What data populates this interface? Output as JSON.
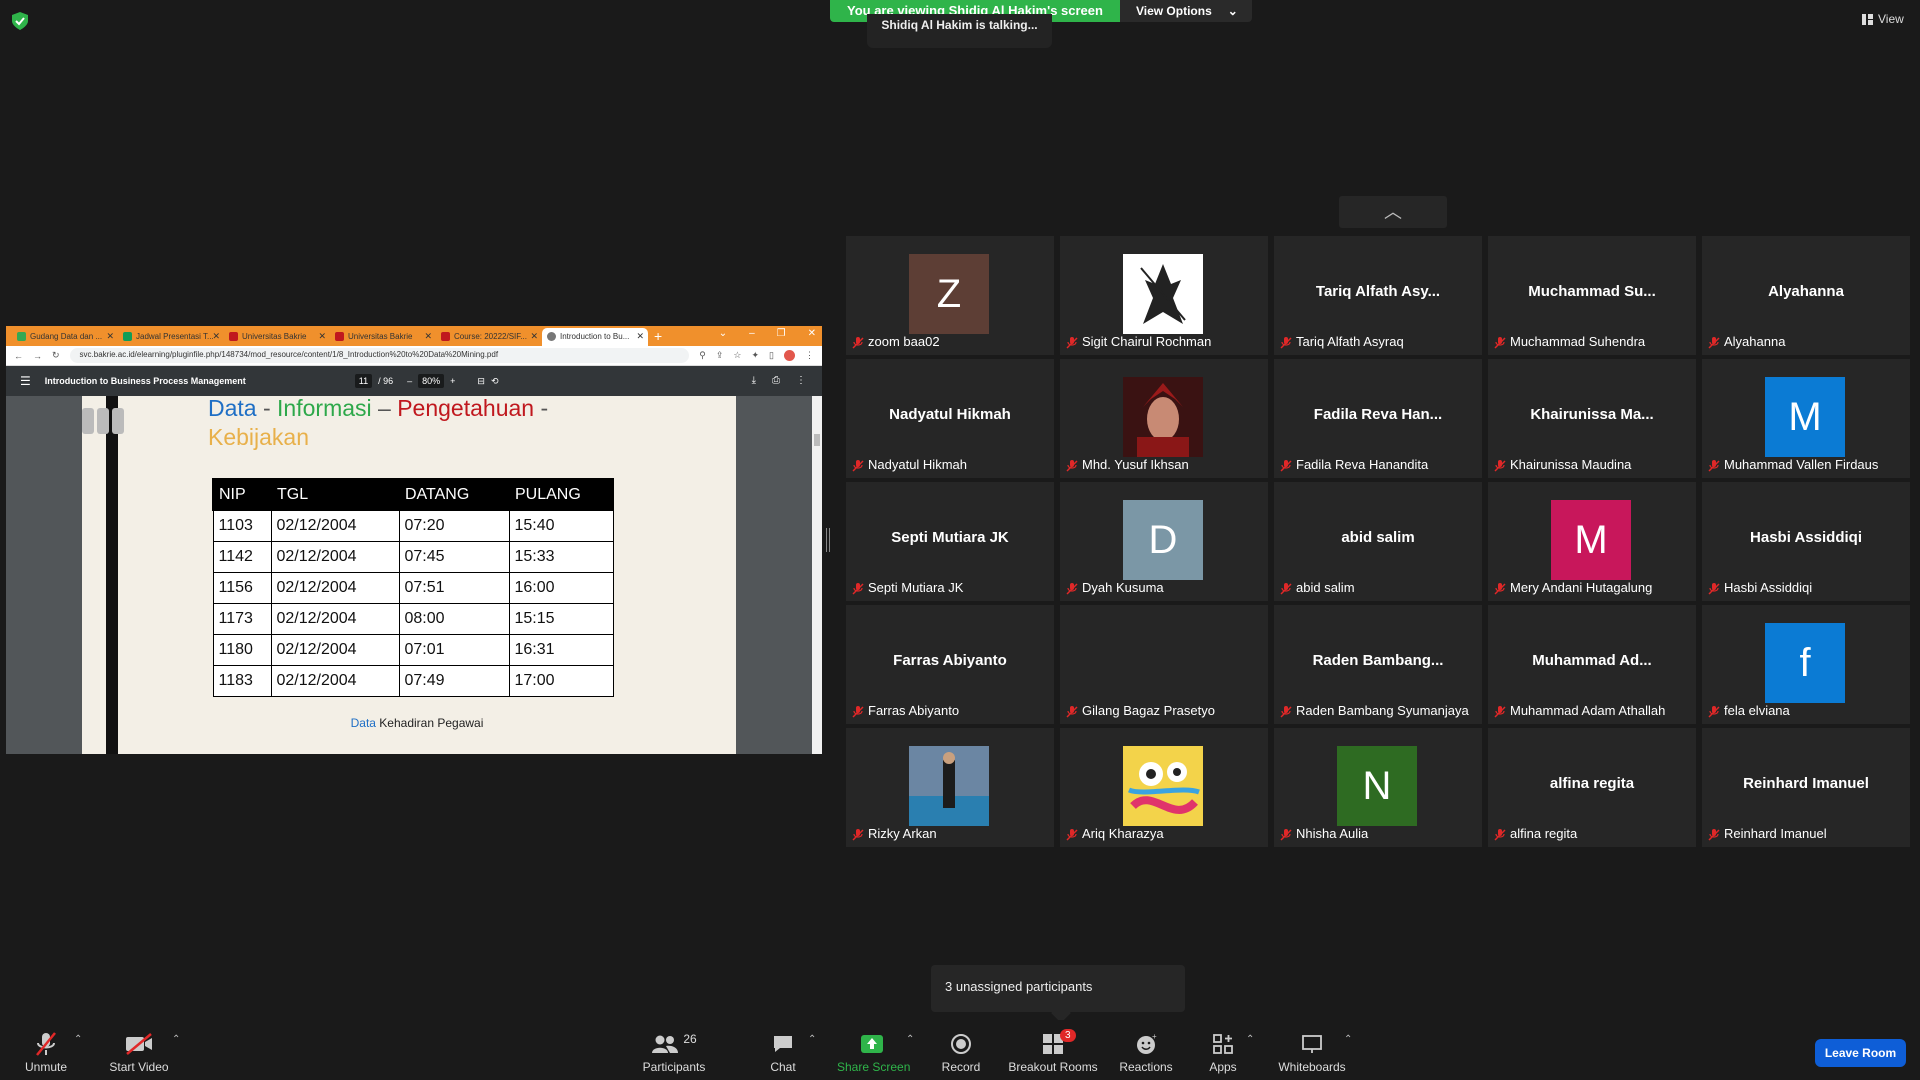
{
  "banner": {
    "viewing": "You are viewing Shidiq Al Hakim's screen",
    "view_options": "View Options"
  },
  "talking": "Shidiq Al Hakim is talking...",
  "view_button": "View",
  "browser": {
    "tabs": [
      "Gudang Data dan ...",
      "Jadwal Presentasi T...",
      "Universitas Bakrie",
      "Universitas Bakrie",
      "Course: 20222/SIF...",
      "Introduction to Bu..."
    ],
    "url": "svc.bakrie.ac.id/elearning/pluginfile.php/148734/mod_resource/content/1/8_Introduction%20to%20Data%20Mining.pdf",
    "pdf_title": "Introduction to Business Process Management",
    "page_current": "11",
    "page_total": "/ 96",
    "zoom": "80%"
  },
  "slide": {
    "title_parts": [
      "Data",
      " - ",
      "Informasi",
      " – ",
      "Pengetahuan",
      " - "
    ],
    "title_line2": "Kebijakan",
    "table_headers": [
      "NIP",
      "TGL",
      "DATANG",
      "PULANG"
    ],
    "table_rows": [
      [
        "1103",
        "02/12/2004",
        "07:20",
        "15:40"
      ],
      [
        "1142",
        "02/12/2004",
        "07:45",
        "15:33"
      ],
      [
        "1156",
        "02/12/2004",
        "07:51",
        "16:00"
      ],
      [
        "1173",
        "02/12/2004",
        "08:00",
        "15:15"
      ],
      [
        "1180",
        "02/12/2004",
        "07:01",
        "16:31"
      ],
      [
        "1183",
        "02/12/2004",
        "07:49",
        "17:00"
      ]
    ],
    "caption_accent": "Data",
    "caption_rest": " Kehadiran Pegawai"
  },
  "participants": [
    {
      "name": "zoom baa02",
      "avatar_letter": "Z",
      "avatar_color": "#5d3e35"
    },
    {
      "name": "Sigit Chairul Rochman",
      "image": "samurai"
    },
    {
      "name": "Tariq Alfath Asyraq",
      "display": "Tariq Alfath Asy..."
    },
    {
      "name": "Muchammad Suhendra",
      "display": "Muchammad  Su..."
    },
    {
      "name": "Alyahanna",
      "display": "Alyahanna"
    },
    {
      "name": "Nadyatul Hikmah",
      "display": "Nadyatul Hikmah"
    },
    {
      "name": "Mhd. Yusuf Ikhsan",
      "image": "portrait-red"
    },
    {
      "name": "Fadila Reva Hanandita",
      "display": "Fadila  Reva  Han..."
    },
    {
      "name": "Khairunissa Maudina",
      "display": "Khairunissa  Ma..."
    },
    {
      "name": "Muhammad Vallen Firdaus",
      "avatar_letter": "M",
      "avatar_color": "#0b7bd4"
    },
    {
      "name": "Septi Mutiara JK",
      "display": "Septi Mutiara JK"
    },
    {
      "name": "Dyah Kusuma",
      "avatar_letter": "D",
      "avatar_color": "#7b97a6"
    },
    {
      "name": "abid salim",
      "display": "abid salim"
    },
    {
      "name": "Mery Andani Hutagalung",
      "avatar_letter": "M",
      "avatar_color": "#c8175b"
    },
    {
      "name": "Hasbi Assiddiqi",
      "display": "Hasbi Assiddiqi"
    },
    {
      "name": "Farras Abiyanto",
      "display": "Farras Abiyanto"
    },
    {
      "name": "Gilang Bagaz Prasetyo",
      "display": ""
    },
    {
      "name": "Raden Bambang Syumanjaya",
      "display": "Raden  Bambang..."
    },
    {
      "name": "Muhammad Adam Athallah",
      "display": "Muhammad  Ad..."
    },
    {
      "name": "fela elviana",
      "avatar_letter": "f",
      "avatar_color": "#0b7bd4"
    },
    {
      "name": "Rizky Arkan",
      "image": "photo-pool"
    },
    {
      "name": "Ariq Kharazya",
      "image": "art-colorful"
    },
    {
      "name": "Nhisha Aulia",
      "avatar_letter": "N",
      "avatar_color": "#2e6b22"
    },
    {
      "name": "alfina regita",
      "display": "alfina regita"
    },
    {
      "name": "Reinhard Imanuel",
      "display": "Reinhard Imanuel"
    }
  ],
  "unassigned": "3 unassigned participants",
  "toolbar": {
    "unmute": "Unmute",
    "start_video": "Start Video",
    "participants": "Participants",
    "participants_count": "26",
    "chat": "Chat",
    "share_screen": "Share Screen",
    "record": "Record",
    "breakout_rooms": "Breakout Rooms",
    "breakout_badge": "3",
    "reactions": "Reactions",
    "apps": "Apps",
    "whiteboards": "Whiteboards",
    "leave": "Leave Room"
  },
  "colors": {
    "green": "#2fb44a",
    "blue": "#0e5ed7",
    "muted_red": "#e02828",
    "title_blue": "#1f6fc5",
    "title_green": "#2da84a",
    "title_red": "#c0181e",
    "title_gold": "#e8b04a"
  }
}
